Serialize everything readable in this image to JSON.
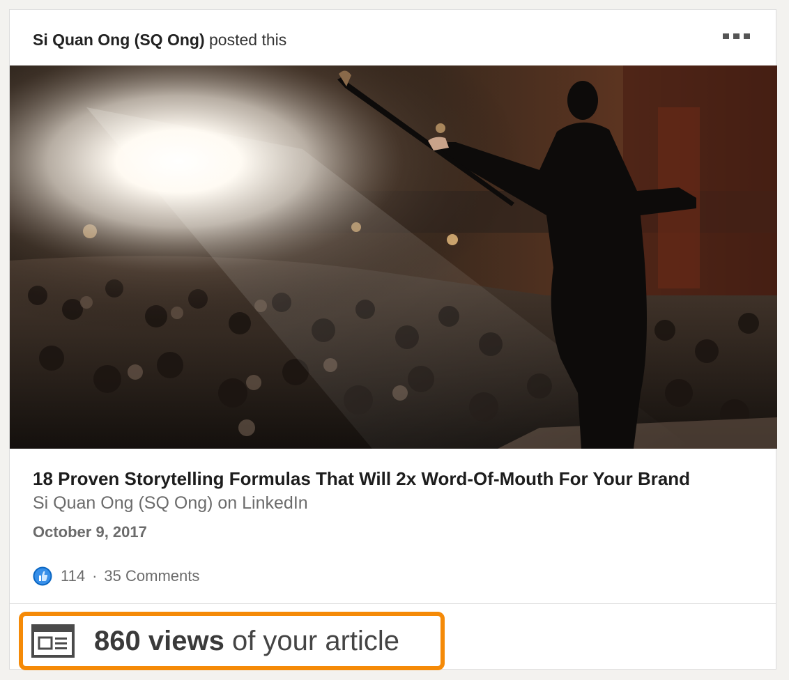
{
  "post": {
    "author": "Si Quan Ong (SQ Ong)",
    "action": "posted this",
    "more_icon": "ellipsis-icon"
  },
  "article": {
    "title": "18 Proven Storytelling Formulas That Will 2x Word-Of-Mouth For Your Brand",
    "source": "Si Quan Ong (SQ Ong) on LinkedIn",
    "date": "October 9, 2017",
    "image_icon": "theatre-performer-photo"
  },
  "social": {
    "like_icon": "thumbs-up-icon",
    "likes": "114",
    "separator": "·",
    "comments": "35 Comments"
  },
  "views": {
    "icon": "article-icon",
    "count": "860 views",
    "suffix": "of your article",
    "highlight_color": "#f58a07"
  }
}
